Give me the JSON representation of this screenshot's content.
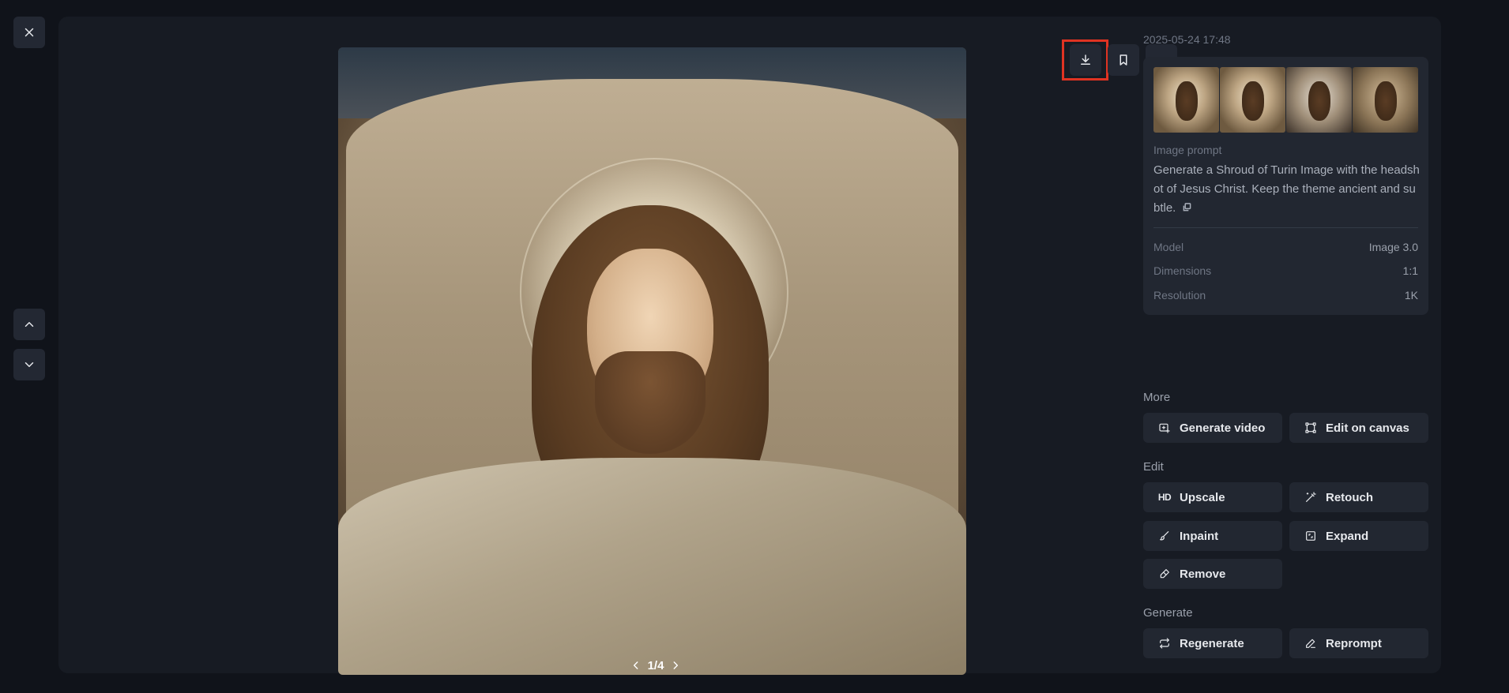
{
  "image": {
    "pager": "1/4",
    "timestamp": "2025-05-24 17:48"
  },
  "info": {
    "prompt_label": "Image prompt",
    "prompt_text": "Generate a Shroud of Turin Image with the headsh ot of Jesus Christ. Keep the theme ancient and su btle.",
    "meta": {
      "model_label": "Model",
      "model_value": "Image 3.0",
      "dim_label": "Dimensions",
      "dim_value": "1:1",
      "res_label": "Resolution",
      "res_value": "1K"
    }
  },
  "sections": {
    "more_title": "More",
    "edit_title": "Edit",
    "generate_title": "Generate"
  },
  "actions": {
    "generate_video": "Generate video",
    "edit_on_canvas": "Edit on canvas",
    "upscale": "Upscale",
    "upscale_badge": "HD",
    "retouch": "Retouch",
    "inpaint": "Inpaint",
    "expand": "Expand",
    "remove": "Remove",
    "regenerate": "Regenerate",
    "reprompt": "Reprompt"
  },
  "colors": {
    "background": "#10131a",
    "panel": "#171b23",
    "card": "#222731",
    "highlight": "#e03322"
  }
}
